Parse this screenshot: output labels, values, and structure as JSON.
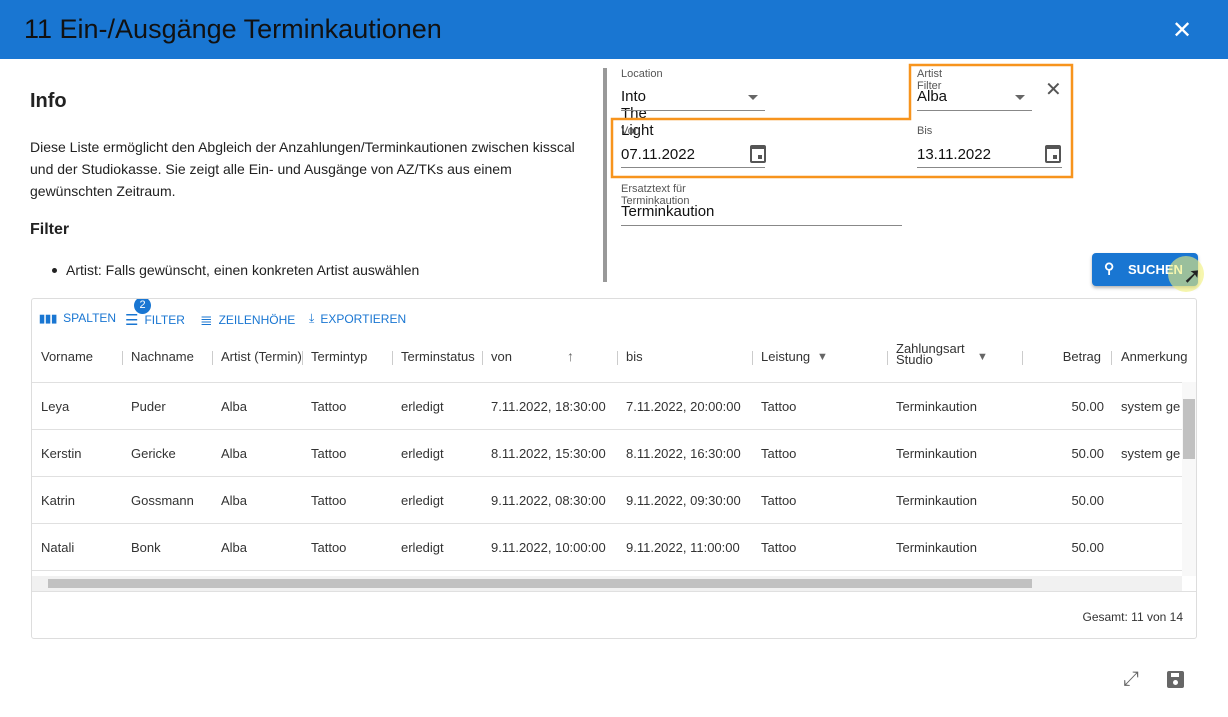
{
  "dialog": {
    "title": "11 Ein-/Ausgänge Terminkautionen",
    "accent": "#1976d2",
    "highlight": "#f7941d"
  },
  "info": {
    "heading": "Info",
    "text_line1": "Diese Liste ermöglicht den Abgleich der Anzahlungen/Terminkautionen zwischen kisscal",
    "text_line2": "und der Studiokasse. Sie zeigt alle Ein- und Ausgänge von AZ/TKs aus einem",
    "text_line3": "gewünschten Zeitraum.",
    "filter_heading": "Filter",
    "filter_item": "Artist: Falls gewünscht, einen konkreten Artist auswählen"
  },
  "form": {
    "location": {
      "label": "Location",
      "value": "Into The Light"
    },
    "artist": {
      "label": "Artist Filter",
      "value": "Alba"
    },
    "von": {
      "label": "Von",
      "value": "07.11.2022"
    },
    "bis": {
      "label": "Bis",
      "value": "13.11.2022"
    },
    "ersatz": {
      "label": "Ersatztext für Terminkaution",
      "value": "Terminkaution"
    },
    "search_label": "SUCHEN"
  },
  "toolbar": {
    "columns": "SPALTEN",
    "filter": "FILTER",
    "filter_count": "2",
    "density": "ZEILENHÖHE",
    "export": "EXPORTIEREN"
  },
  "columns": [
    "Vorname",
    "Nachname",
    "Artist (Termin)",
    "Termintyp",
    "Terminstatus",
    "von",
    "bis",
    "Leistung",
    "Zahlungsart Studio",
    "Betrag",
    "Anmerkung"
  ],
  "rows": [
    [
      "Leya",
      "Puder",
      "Alba",
      "Tattoo",
      "erledigt",
      "7.11.2022, 18:30:00",
      "7.11.2022, 20:00:00",
      "Tattoo",
      "Terminkaution",
      "50.00",
      "system ge"
    ],
    [
      "Kerstin",
      "Gericke",
      "Alba",
      "Tattoo",
      "erledigt",
      "8.11.2022, 15:30:00",
      "8.11.2022, 16:30:00",
      "Tattoo",
      "Terminkaution",
      "50.00",
      "system ge"
    ],
    [
      "Katrin",
      "Gossmann",
      "Alba",
      "Tattoo",
      "erledigt",
      "9.11.2022, 08:30:00",
      "9.11.2022, 09:30:00",
      "Tattoo",
      "Terminkaution",
      "50.00",
      ""
    ],
    [
      "Natali",
      "Bonk",
      "Alba",
      "Tattoo",
      "erledigt",
      "9.11.2022, 10:00:00",
      "9.11.2022, 11:00:00",
      "Tattoo",
      "Terminkaution",
      "50.00",
      ""
    ]
  ],
  "footer": {
    "total": "Gesamt: 11 von 14"
  }
}
